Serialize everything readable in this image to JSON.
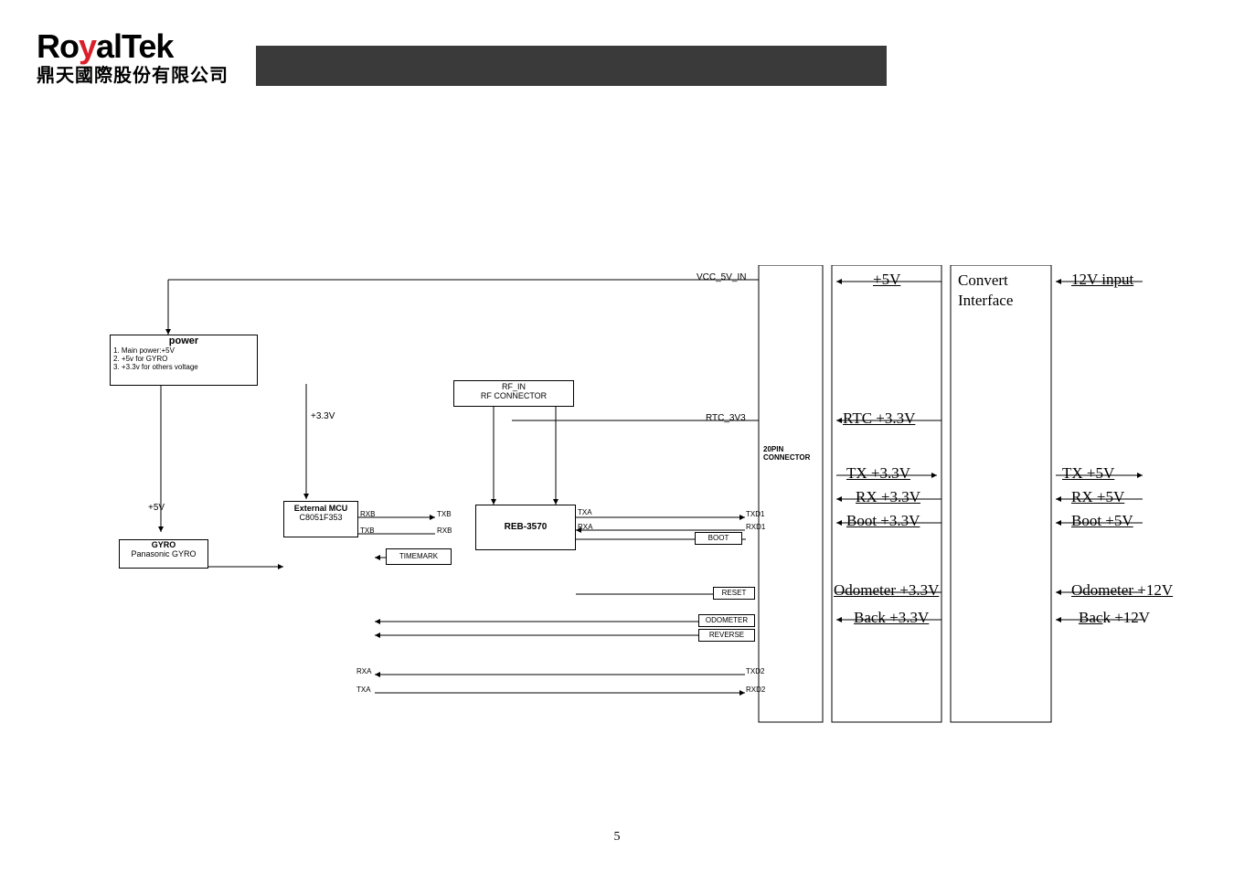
{
  "logo": {
    "main_pre": "Ro",
    "main_y": "y",
    "main_post": "alTek",
    "sub": "鼎天國際股份有限公司"
  },
  "page_number": "5",
  "diagram": {
    "power": {
      "title": "power",
      "line1": "1. Main power:+5V",
      "line2": "2. +5v for GYRO",
      "line3": "3. +3.3v for others voltage"
    },
    "ext_mcu": {
      "title": "External MCU",
      "sub": "C8051F353"
    },
    "gyro": {
      "title": "GYRO",
      "sub": "Panasonic GYRO"
    },
    "rf": {
      "line1": "RF_IN",
      "line2": "RF CONNECTOR"
    },
    "reb": "REB-3570",
    "timemark": "TIMEMARK",
    "v33": "+3.3V",
    "v5": "+5V",
    "rxb": "RXB",
    "txb": "TXB",
    "txa": "TXA",
    "rxa": "RXA",
    "txd1": "TXD1",
    "rxd1": "RXD1",
    "txd2": "TXD2",
    "rxd2": "RXD2",
    "boot": "BOOT",
    "reset": "RESET",
    "odometer": "ODOMETER",
    "reverse": "REVERSE",
    "vcc5vin": "VCC_5V_IN",
    "rtc3v3": "RTC_3V3",
    "conn20": {
      "line1": "20PIN",
      "line2": "CONNECTOR"
    },
    "connector_box": {
      "p5v": "+5V",
      "rtc33": "RTC +3.3V",
      "tx33": "TX +3.3V",
      "rx33": "RX +3.3V",
      "boot33": "Boot +3.3V",
      "odo33": "Odometer +3.3V",
      "back33": "Back +3.3V"
    },
    "convert": {
      "line1": "Convert",
      "line2": "Interface"
    },
    "right": {
      "v12in": "12V input",
      "tx5v": "TX +5V",
      "rx5v": "RX +5V",
      "boot5v": "Boot +5V",
      "odo12": "Odometer +12V",
      "back12": "Back +12V"
    }
  }
}
